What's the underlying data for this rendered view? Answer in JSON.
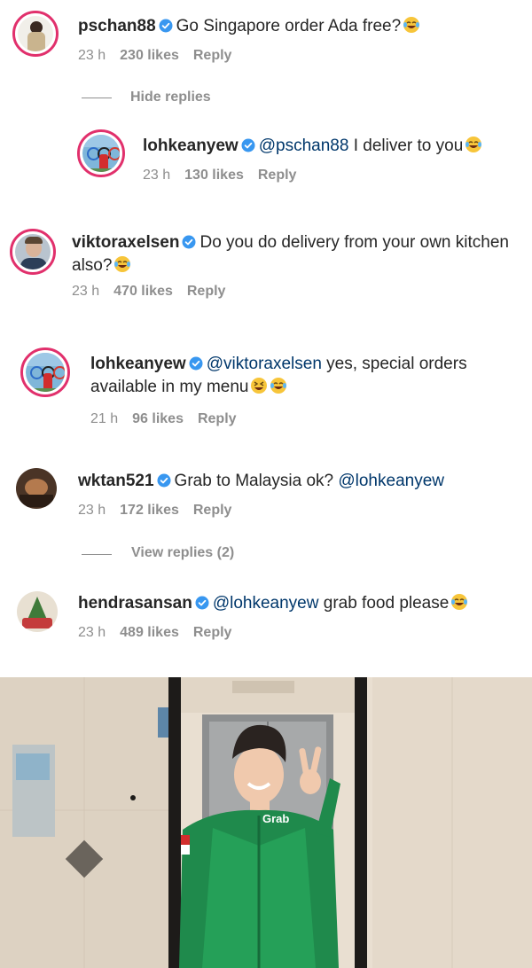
{
  "comments": [
    {
      "username": "pschan88",
      "text_before": "Go Singapore order Ada free?",
      "mention": "",
      "text_after": "",
      "time": "23 h",
      "likes": "230 likes",
      "reply": "Reply"
    },
    {
      "username": "lohkeanyew",
      "text_before": "",
      "mention": "@pschan88",
      "text_after": " I deliver to you",
      "time": "23 h",
      "likes": "130 likes",
      "reply": "Reply"
    },
    {
      "username": "viktoraxelsen",
      "text_before": "Do you do delivery from your own kitchen also?",
      "mention": "",
      "text_after": "",
      "time": "23 h",
      "likes": "470 likes",
      "reply": "Reply"
    },
    {
      "username": "lohkeanyew",
      "text_before": "",
      "mention": "@viktoraxelsen",
      "text_after": " yes, special orders available in my menu",
      "time": "21 h",
      "likes": "96 likes",
      "reply": "Reply"
    },
    {
      "username": "wktan521",
      "text_before": "Grab to Malaysia ok? ",
      "mention": "@lohkeanyew",
      "text_after": "",
      "time": "23 h",
      "likes": "172 likes",
      "reply": "Reply"
    },
    {
      "username": "hendrasansan",
      "text_before": "",
      "mention": "@lohkeanyew",
      "text_after": " grab food please",
      "time": "23 h",
      "likes": "489 likes",
      "reply": "Reply"
    }
  ],
  "hide_replies": "Hide replies",
  "view_replies": "View replies (2)",
  "photo": {
    "jacket_logo": "Grab"
  },
  "colors": {
    "verified": "#3897f0",
    "mention": "#00376b",
    "muted": "#8e8e8e",
    "grab_green": "#1f8a4c"
  }
}
